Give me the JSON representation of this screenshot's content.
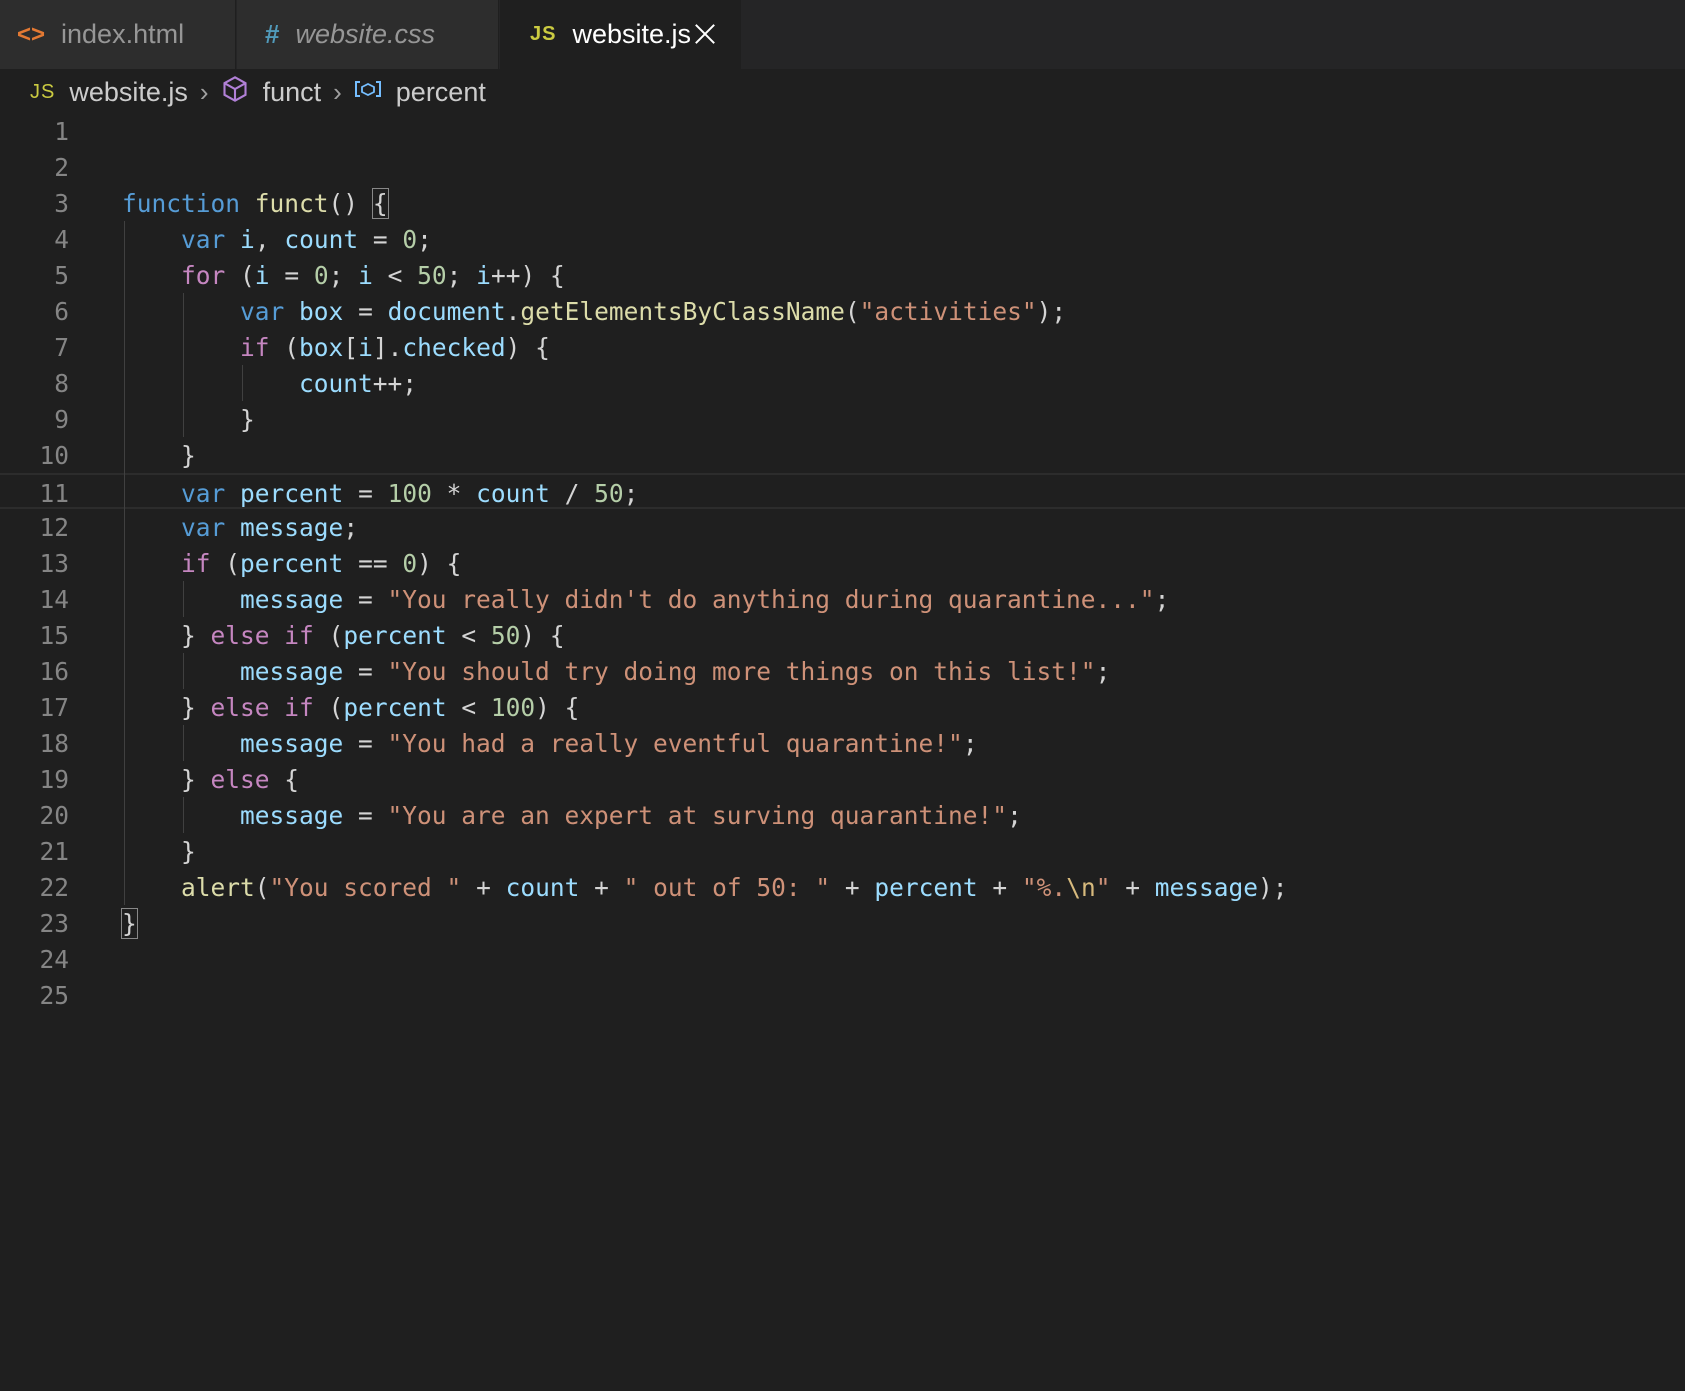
{
  "tabs": [
    {
      "label": "index.html",
      "icon": "html-icon",
      "icon_glyph": "<>"
    },
    {
      "label": "website.css",
      "icon": "css-hash-icon",
      "icon_glyph": "#"
    },
    {
      "label": "website.js",
      "icon": "js-icon",
      "icon_glyph": "JS",
      "active": true
    }
  ],
  "breadcrumb": {
    "file": "website.js",
    "file_icon": "JS",
    "symbol": "funct",
    "variable": "percent"
  },
  "editor": {
    "current_line": 11,
    "lines": [
      {
        "n": "1"
      },
      {
        "n": "2"
      },
      {
        "n": "3"
      },
      {
        "n": "4"
      },
      {
        "n": "5"
      },
      {
        "n": "6"
      },
      {
        "n": "7"
      },
      {
        "n": "8"
      },
      {
        "n": "9"
      },
      {
        "n": "10"
      },
      {
        "n": "11"
      },
      {
        "n": "12"
      },
      {
        "n": "13"
      },
      {
        "n": "14"
      },
      {
        "n": "15"
      },
      {
        "n": "16"
      },
      {
        "n": "17"
      },
      {
        "n": "18"
      },
      {
        "n": "19"
      },
      {
        "n": "20"
      },
      {
        "n": "21"
      },
      {
        "n": "22"
      },
      {
        "n": "23"
      },
      {
        "n": "24"
      },
      {
        "n": "25"
      }
    ],
    "code": {
      "l3": [
        [
          "kw",
          "function"
        ],
        [
          "pn",
          " "
        ],
        [
          "fn",
          "funct"
        ],
        [
          "pn",
          "() "
        ],
        [
          "box",
          "{"
        ]
      ],
      "l4": [
        [
          "pn",
          "    "
        ],
        [
          "kw",
          "var"
        ],
        [
          "pn",
          " "
        ],
        [
          "var",
          "i"
        ],
        [
          "pn",
          ", "
        ],
        [
          "var",
          "count"
        ],
        [
          "pn",
          " = "
        ],
        [
          "num",
          "0"
        ],
        [
          "pn",
          ";"
        ]
      ],
      "l5": [
        [
          "pn",
          "    "
        ],
        [
          "ctl",
          "for"
        ],
        [
          "pn",
          " ("
        ],
        [
          "var",
          "i"
        ],
        [
          "pn",
          " = "
        ],
        [
          "num",
          "0"
        ],
        [
          "pn",
          "; "
        ],
        [
          "var",
          "i"
        ],
        [
          "pn",
          " < "
        ],
        [
          "num",
          "50"
        ],
        [
          "pn",
          "; "
        ],
        [
          "var",
          "i"
        ],
        [
          "pn",
          "++) {"
        ]
      ],
      "l6": [
        [
          "pn",
          "        "
        ],
        [
          "kw",
          "var"
        ],
        [
          "pn",
          " "
        ],
        [
          "var",
          "box"
        ],
        [
          "pn",
          " = "
        ],
        [
          "var",
          "document"
        ],
        [
          "pn",
          "."
        ],
        [
          "fn",
          "getElementsByClassName"
        ],
        [
          "pn",
          "("
        ],
        [
          "str",
          "\"activities\""
        ],
        [
          "pn",
          ");"
        ]
      ],
      "l7": [
        [
          "pn",
          "        "
        ],
        [
          "ctl",
          "if"
        ],
        [
          "pn",
          " ("
        ],
        [
          "var",
          "box"
        ],
        [
          "pn",
          "["
        ],
        [
          "var",
          "i"
        ],
        [
          "pn",
          "]."
        ],
        [
          "var",
          "checked"
        ],
        [
          "pn",
          ") {"
        ]
      ],
      "l8": [
        [
          "pn",
          "            "
        ],
        [
          "var",
          "count"
        ],
        [
          "pn",
          "++;"
        ]
      ],
      "l9": [
        [
          "pn",
          "        }"
        ]
      ],
      "l10": [
        [
          "pn",
          "    }"
        ]
      ],
      "l11": [
        [
          "pn",
          "    "
        ],
        [
          "kw",
          "var"
        ],
        [
          "pn",
          " "
        ],
        [
          "var",
          "percent"
        ],
        [
          "pn",
          " = "
        ],
        [
          "num",
          "100"
        ],
        [
          "pn",
          " * "
        ],
        [
          "var",
          "count"
        ],
        [
          "pn",
          " / "
        ],
        [
          "num",
          "50"
        ],
        [
          "pn",
          ";"
        ]
      ],
      "l12": [
        [
          "pn",
          "    "
        ],
        [
          "kw",
          "var"
        ],
        [
          "pn",
          " "
        ],
        [
          "var",
          "message"
        ],
        [
          "pn",
          ";"
        ]
      ],
      "l13": [
        [
          "pn",
          "    "
        ],
        [
          "ctl",
          "if"
        ],
        [
          "pn",
          " ("
        ],
        [
          "var",
          "percent"
        ],
        [
          "pn",
          " == "
        ],
        [
          "num",
          "0"
        ],
        [
          "pn",
          ") {"
        ]
      ],
      "l14": [
        [
          "pn",
          "        "
        ],
        [
          "var",
          "message"
        ],
        [
          "pn",
          " = "
        ],
        [
          "str",
          "\"You really didn't do anything during quarantine...\""
        ],
        [
          "pn",
          ";"
        ]
      ],
      "l15": [
        [
          "pn",
          "    } "
        ],
        [
          "ctl",
          "else"
        ],
        [
          "pn",
          " "
        ],
        [
          "ctl",
          "if"
        ],
        [
          "pn",
          " ("
        ],
        [
          "var",
          "percent"
        ],
        [
          "pn",
          " < "
        ],
        [
          "num",
          "50"
        ],
        [
          "pn",
          ") {"
        ]
      ],
      "l16": [
        [
          "pn",
          "        "
        ],
        [
          "var",
          "message"
        ],
        [
          "pn",
          " = "
        ],
        [
          "str",
          "\"You should try doing more things on this list!\""
        ],
        [
          "pn",
          ";"
        ]
      ],
      "l17": [
        [
          "pn",
          "    } "
        ],
        [
          "ctl",
          "else"
        ],
        [
          "pn",
          " "
        ],
        [
          "ctl",
          "if"
        ],
        [
          "pn",
          " ("
        ],
        [
          "var",
          "percent"
        ],
        [
          "pn",
          " < "
        ],
        [
          "num",
          "100"
        ],
        [
          "pn",
          ") {"
        ]
      ],
      "l18": [
        [
          "pn",
          "        "
        ],
        [
          "var",
          "message"
        ],
        [
          "pn",
          " = "
        ],
        [
          "str",
          "\"You had a really eventful quarantine!\""
        ],
        [
          "pn",
          ";"
        ]
      ],
      "l19": [
        [
          "pn",
          "    } "
        ],
        [
          "ctl",
          "else"
        ],
        [
          "pn",
          " {"
        ]
      ],
      "l20": [
        [
          "pn",
          "        "
        ],
        [
          "var",
          "message"
        ],
        [
          "pn",
          " = "
        ],
        [
          "str",
          "\"You are an expert at surving quarantine!\""
        ],
        [
          "pn",
          ";"
        ]
      ],
      "l21": [
        [
          "pn",
          "    }"
        ]
      ],
      "l22": [
        [
          "pn",
          "    "
        ],
        [
          "fn",
          "alert"
        ],
        [
          "pn",
          "("
        ],
        [
          "str",
          "\"You scored \""
        ],
        [
          "pn",
          " + "
        ],
        [
          "var",
          "count"
        ],
        [
          "pn",
          " + "
        ],
        [
          "str",
          "\" out of 50: \""
        ],
        [
          "pn",
          " + "
        ],
        [
          "var",
          "percent"
        ],
        [
          "pn",
          " + "
        ],
        [
          "str",
          "\"%."
        ],
        [
          "esc",
          "\\n"
        ],
        [
          "str",
          "\""
        ],
        [
          "pn",
          " + "
        ],
        [
          "var",
          "message"
        ],
        [
          "pn",
          ");"
        ]
      ],
      "l23": [
        [
          "box",
          "}"
        ]
      ]
    }
  },
  "colors": {
    "background": "#1f1f1f",
    "tabbar": "#252526",
    "keyword": "#569cd6",
    "control": "#c586c0",
    "function": "#dcdcaa",
    "variable": "#9cdcfe",
    "number": "#b5cea8",
    "string": "#ce9178"
  }
}
